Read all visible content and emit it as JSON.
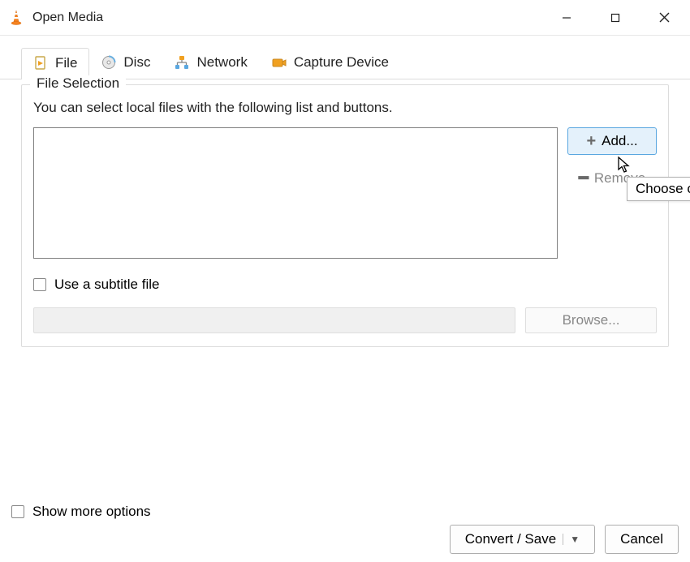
{
  "window": {
    "title": "Open Media"
  },
  "tabs": {
    "file": "File",
    "disc": "Disc",
    "network": "Network",
    "capture": "Capture Device"
  },
  "file_selection": {
    "group_title": "File Selection",
    "help": "You can select local files with the following list and buttons.",
    "add_label": "Add...",
    "remove_label": "Remove",
    "tooltip": "Choose o"
  },
  "subtitle": {
    "checkbox_label": "Use a subtitle file",
    "browse_label": "Browse..."
  },
  "footer": {
    "show_more": "Show more options",
    "convert_label": "Convert / Save",
    "cancel_label": "Cancel"
  }
}
